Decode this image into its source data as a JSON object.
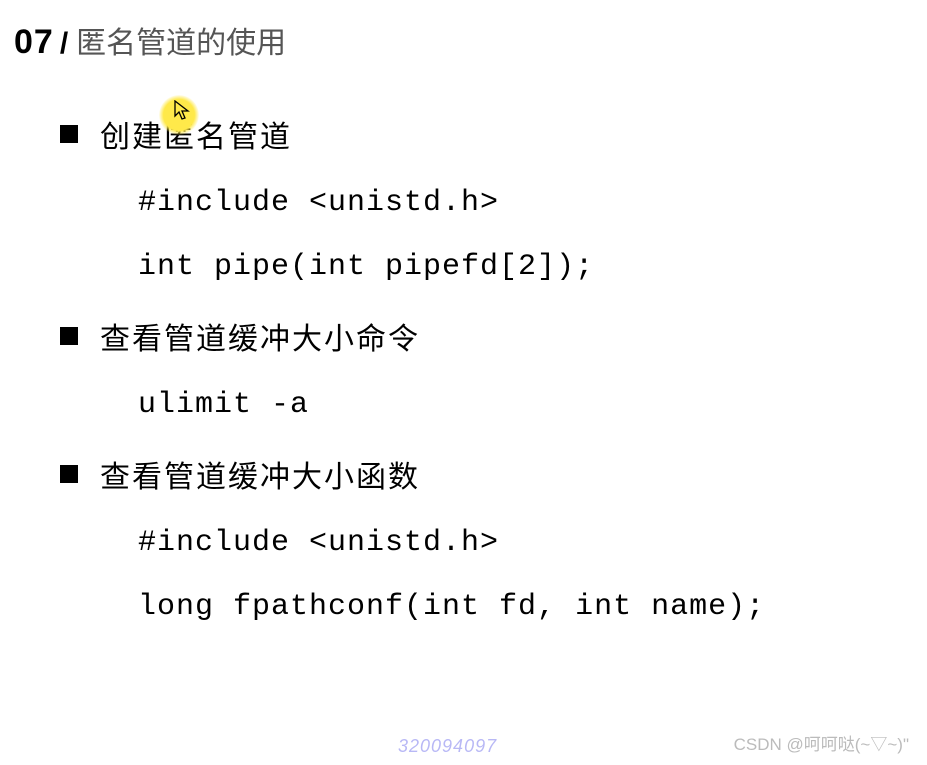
{
  "header": {
    "page_number": "07",
    "slash": "/",
    "title": "匿名管道的使用"
  },
  "sections": [
    {
      "heading": "创建匿名管道",
      "code_lines": [
        "#include <unistd.h>",
        "int pipe(int pipefd[2]);"
      ]
    },
    {
      "heading": "查看管道缓冲大小命令",
      "code_lines": [
        "ulimit -a"
      ]
    },
    {
      "heading": "查看管道缓冲大小函数",
      "code_lines": [
        "#include <unistd.h>",
        "long fpathconf(int fd, int name);"
      ]
    }
  ],
  "watermark": {
    "number": "320094097",
    "csdn": "CSDN @呵呵哒(~▽~)\""
  }
}
